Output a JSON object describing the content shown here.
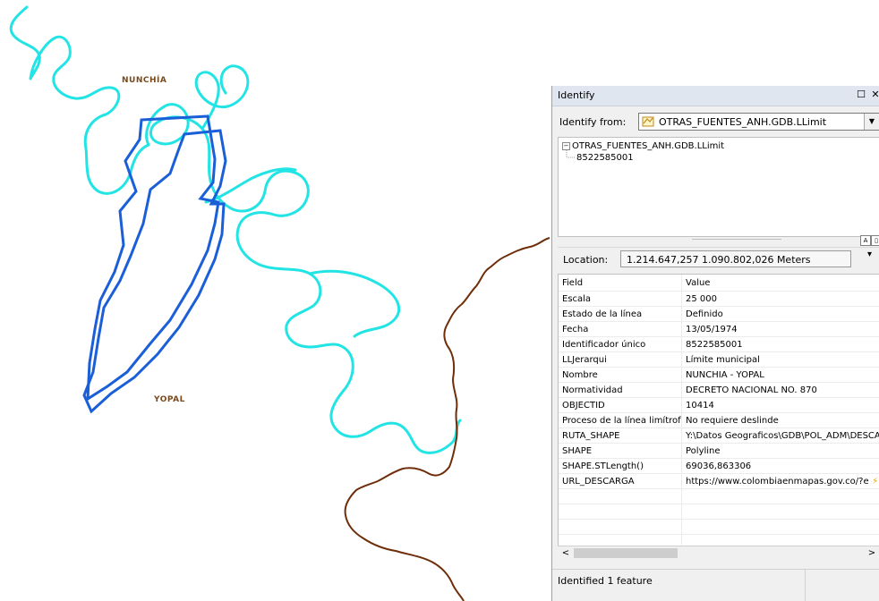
{
  "map": {
    "labels": {
      "nunchia": "NUNCHÍA",
      "yopal": "YOPAL"
    },
    "colors": {
      "river": "#22e4e4",
      "boundary": "#1a5fd8",
      "stream": "#6e2e0a",
      "label": "#7a4a1c"
    }
  },
  "identify": {
    "title": "Identify",
    "window_buttons": {
      "maximize_icon": "maximize-icon",
      "close_icon": "close-icon"
    },
    "from_label": "Identify from:",
    "from_value": "OTRAS_FUENTES_ANH.GDB.LLimit",
    "tree": {
      "layer": "OTRAS_FUENTES_ANH.GDB.LLimit",
      "feature": "8522585001"
    },
    "location_label": "Location:",
    "location_value": "1.214.647,257  1.090.802,026 Meters",
    "table": {
      "headers": {
        "field": "Field",
        "value": "Value"
      },
      "rows": [
        {
          "field": "Escala",
          "value": "25 000"
        },
        {
          "field": "Estado de la línea",
          "value": "Definido"
        },
        {
          "field": "Fecha",
          "value": "13/05/1974"
        },
        {
          "field": "Identificador único",
          "value": "8522585001"
        },
        {
          "field": "LLJerarqui",
          "value": "Límite municipal"
        },
        {
          "field": "Nombre",
          "value": "NUNCHIA - YOPAL"
        },
        {
          "field": "Normatividad",
          "value": "DECRETO NACIONAL NO. 870"
        },
        {
          "field": "OBJECTID",
          "value": "10414"
        },
        {
          "field": "Proceso de la línea limítrofe",
          "value": "No requiere deslinde"
        },
        {
          "field": "RUTA_SHAPE",
          "value": "Y:\\Datos Geograficos\\GDB\\POL_ADM\\DESCA"
        },
        {
          "field": "SHAPE",
          "value": "Polyline"
        },
        {
          "field": "SHAPE.STLength()",
          "value": "69036,863306"
        },
        {
          "field": "URL_DESCARGA",
          "value": "https://www.colombiaenmapas.gov.co/?e"
        }
      ]
    },
    "status": "Identified 1 feature"
  }
}
